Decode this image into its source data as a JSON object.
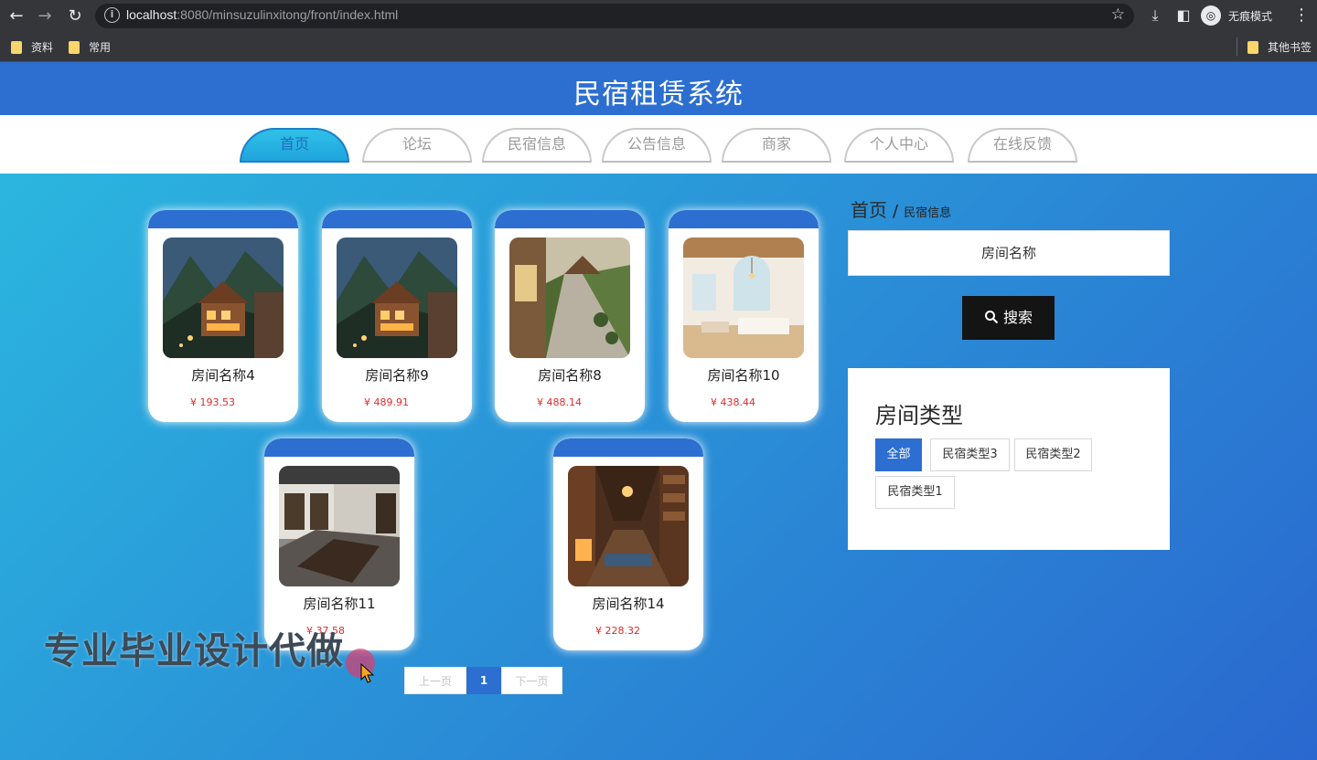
{
  "browser": {
    "url_host": "localhost",
    "url_rest": ":8080/minsuzulinxitong/front/index.html",
    "incognito_label": "无痕模式",
    "bookmarks": [
      "资料",
      "常用"
    ],
    "other_bookmarks": "其他书签"
  },
  "site": {
    "title": "民宿租赁系统",
    "menu": [
      "首页",
      "论坛",
      "民宿信息",
      "公告信息",
      "商家",
      "个人中心",
      "在线反馈"
    ],
    "active_menu": "首页"
  },
  "rooms": [
    {
      "name": "房间名称4",
      "price": "¥ 193.53",
      "image": "wooden-lodge-night"
    },
    {
      "name": "房间名称9",
      "price": "¥ 489.91",
      "image": "wooden-lodge-night"
    },
    {
      "name": "房间名称8",
      "price": "¥ 488.14",
      "image": "garden-path-courtyard"
    },
    {
      "name": "房间名称10",
      "price": "¥ 438.44",
      "image": "bright-bedroom"
    },
    {
      "name": "房间名称11",
      "price": "¥ 37.58",
      "image": "courtyard-house"
    },
    {
      "name": "房间名称14",
      "price": "¥ 228.32",
      "image": "wooden-interior"
    }
  ],
  "sidebar": {
    "breadcrumb_home": "首页",
    "breadcrumb_sep": "/",
    "breadcrumb_current": "民宿信息",
    "search_placeholder": "房间名称",
    "search_button": "搜索",
    "type_title": "房间类型",
    "types": [
      "全部",
      "民宿类型3",
      "民宿类型2",
      "民宿类型1"
    ],
    "active_type": "全部"
  },
  "pagination": {
    "prev": "上一页",
    "current": "1",
    "next": "下一页"
  },
  "watermark": "专业毕业设计代做",
  "colors": {
    "header_blue": "#2c6fd1",
    "price_red": "#e02c2c",
    "search_button": "#141414"
  }
}
